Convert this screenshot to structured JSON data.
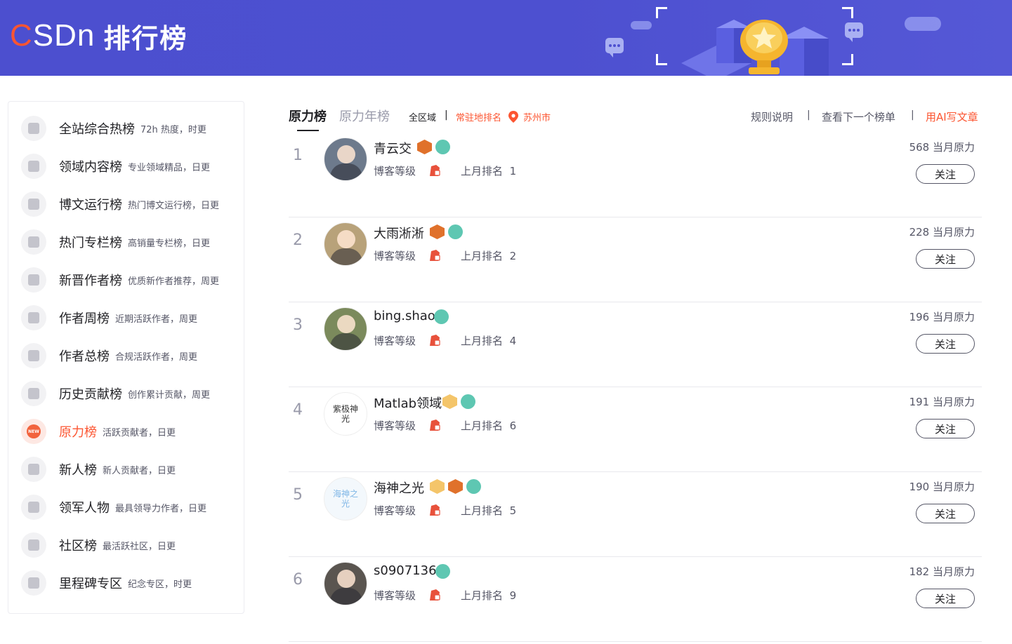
{
  "header": {
    "logo_text_c": "C",
    "logo_text_rest": "SDn",
    "title": "排行榜",
    "colors": {
      "banner": "#4c4fcf",
      "brand_red": "#fc5531"
    }
  },
  "sidebar": {
    "items": [
      {
        "icon": "rocket-icon",
        "label": "全站综合热榜",
        "desc": "72h 热度，时更"
      },
      {
        "icon": "code-icon",
        "label": "领域内容榜",
        "desc": "专业领域精品，日更"
      },
      {
        "icon": "play-icon",
        "label": "博文运行榜",
        "desc": "热门博文运行榜，日更"
      },
      {
        "icon": "bookmark-icon",
        "label": "热门专栏榜",
        "desc": "高销量专栏榜，日更"
      },
      {
        "icon": "person-icon",
        "label": "新晋作者榜",
        "desc": "优质新作者推荐，周更"
      },
      {
        "icon": "calendar-icon",
        "label": "作者周榜",
        "desc": "近期活跃作者，周更"
      },
      {
        "icon": "people-icon",
        "label": "作者总榜",
        "desc": "合规活跃作者，周更"
      },
      {
        "icon": "climb-icon",
        "label": "历史贡献榜",
        "desc": "创作累计贡献，周更"
      },
      {
        "icon": "new-icon",
        "label": "原力榜",
        "desc": "活跃贡献者，日更",
        "active": true
      },
      {
        "icon": "newbie-icon",
        "label": "新人榜",
        "desc": "新人贡献者，日更"
      },
      {
        "icon": "medal-icon",
        "label": "领军人物",
        "desc": "最具领导力作者，日更"
      },
      {
        "icon": "community-icon",
        "label": "社区榜",
        "desc": "最活跃社区，日更"
      },
      {
        "icon": "milestone-icon",
        "label": "里程碑专区",
        "desc": "纪念专区，时更"
      }
    ]
  },
  "tabs": {
    "items": [
      {
        "label": "原力榜",
        "active": true
      },
      {
        "label": "原力年榜"
      }
    ],
    "filter_all": "全区域",
    "separator": "|",
    "filter_local": "常驻地排名",
    "city": "苏州市",
    "rules": "规则说明",
    "next_board": "查看下一个榜单",
    "ai_write": "用AI写文章"
  },
  "list": {
    "level_label": "博客等级",
    "last_rank_label": "上月排名",
    "score_suffix": "当月原力",
    "follow_label": "关注",
    "rows": [
      {
        "rank": "1",
        "name": "青云交",
        "badges": [
          "orange",
          "teal"
        ],
        "last_rank": "1",
        "score": "568",
        "avatar_color": "#6d7a8c"
      },
      {
        "rank": "2",
        "name": "大雨淅淅",
        "badges": [
          "orange",
          "teal"
        ],
        "last_rank": "2",
        "score": "228",
        "avatar_color": "#b8a27a"
      },
      {
        "rank": "3",
        "name": "bing.shao",
        "badges": [
          "teal"
        ],
        "last_rank": "4",
        "score": "196",
        "avatar_color": "#7b8a5c"
      },
      {
        "rank": "4",
        "name": "Matlab领域",
        "badges": [
          "gold",
          "teal"
        ],
        "last_rank": "6",
        "score": "191",
        "avatar_text": "紫极神光",
        "avatar_color": "#ffffff"
      },
      {
        "rank": "5",
        "name": "海神之光",
        "badges": [
          "gold",
          "orange",
          "teal"
        ],
        "last_rank": "5",
        "score": "190",
        "avatar_text": "海神之光",
        "avatar_color": "#f3f8fc"
      },
      {
        "rank": "6",
        "name": "s0907136",
        "badges": [
          "teal"
        ],
        "last_rank": "9",
        "score": "182",
        "avatar_color": "#5a5550"
      }
    ]
  }
}
